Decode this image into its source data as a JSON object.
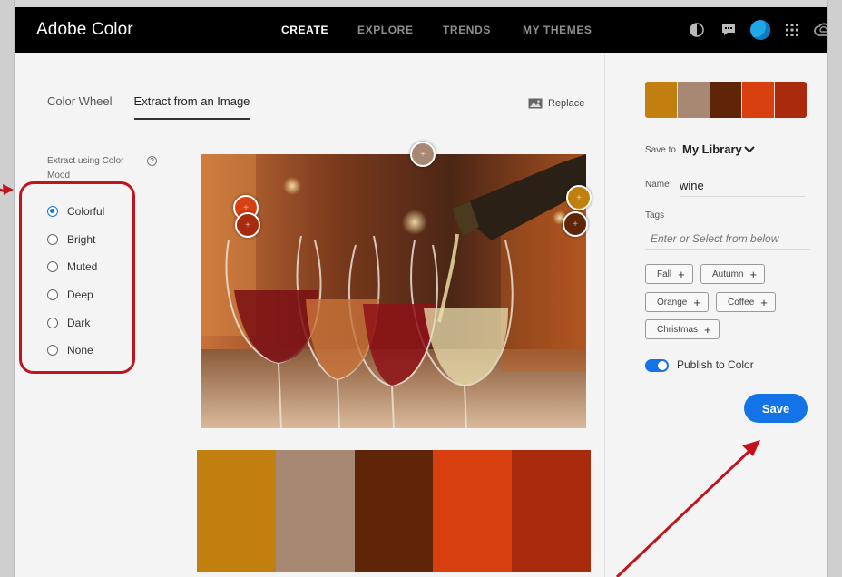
{
  "topbar": {
    "brand": "Adobe Color",
    "nav": [
      "CREATE",
      "EXPLORE",
      "TRENDS",
      "MY THEMES"
    ],
    "active_nav": "CREATE",
    "icons": [
      "contrast-icon",
      "chat-icon",
      "avatar",
      "apps-grid-icon",
      "creative-cloud-icon"
    ]
  },
  "tabs": [
    {
      "label": "Color Wheel",
      "active": false
    },
    {
      "label": "Extract from an Image",
      "active": true
    }
  ],
  "replace_label": "Replace",
  "mood": {
    "label": "Extract using Color Mood",
    "options": [
      "Colorful",
      "Bright",
      "Muted",
      "Deep",
      "Dark",
      "None"
    ],
    "selected": "Colorful"
  },
  "palette": [
    "#c07f0e",
    "#a78872",
    "#5e2509",
    "#d8400f",
    "#a92a0c"
  ],
  "save_panel": {
    "save_to_label": "Save to",
    "save_to_value": "My Library",
    "name_label": "Name",
    "name_value": "wine",
    "tags_label": "Tags",
    "tags_placeholder": "Enter or Select from below",
    "tags": [
      "Fall",
      "Autumn",
      "Orange",
      "Coffee",
      "Christmas"
    ],
    "publish_label": "Publish to Color",
    "publish_on": true,
    "save_label": "Save"
  },
  "colors": {
    "accent": "#1473e6",
    "annotation": "#c0141d"
  }
}
